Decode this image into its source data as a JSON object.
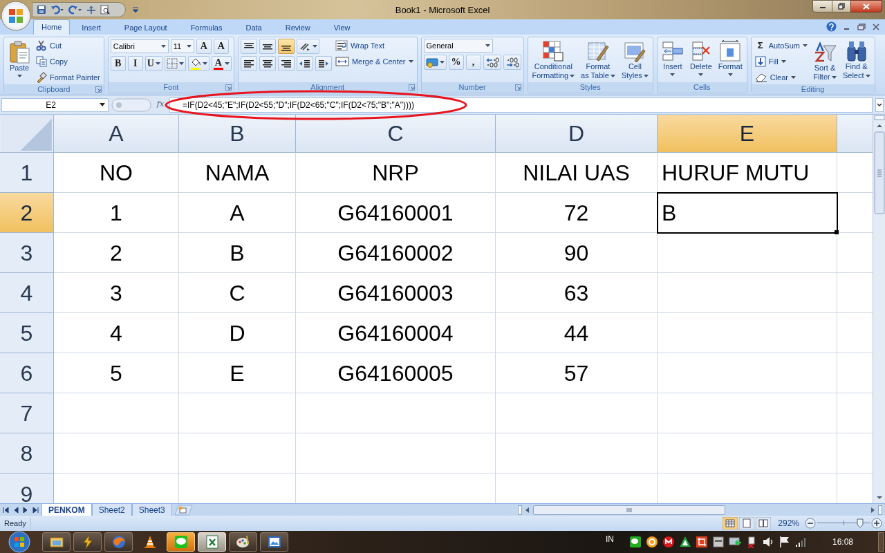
{
  "window": {
    "title": "Book1 - Microsoft Excel"
  },
  "ribbon_tabs": [
    {
      "label": "Home",
      "selected": true
    },
    {
      "label": "Insert",
      "selected": false
    },
    {
      "label": "Page Layout",
      "selected": false
    },
    {
      "label": "Formulas",
      "selected": false
    },
    {
      "label": "Data",
      "selected": false
    },
    {
      "label": "Review",
      "selected": false
    },
    {
      "label": "View",
      "selected": false
    }
  ],
  "ribbon_groups": [
    {
      "label": "Clipboard",
      "launcher": true,
      "columns": [
        [
          [
            {
              "kind": "large",
              "lines": [
                "Paste"
              ],
              "dropdown": true
            }
          ]
        ],
        [
          [
            {
              "kind": "small",
              "label": "Cut"
            }
          ],
          [
            {
              "kind": "small",
              "label": "Copy"
            }
          ],
          [
            {
              "kind": "small",
              "label": "Format Painter"
            }
          ]
        ]
      ]
    },
    {
      "label": "Font",
      "launcher": true,
      "columns": [
        [
          [
            {
              "kind": "field",
              "value": "Calibri"
            },
            {
              "kind": "field",
              "value": "11"
            },
            {
              "kind": "icon",
              "glyph": "A",
              "on": false
            },
            {
              "kind": "icon",
              "glyph": "A",
              "on": false
            }
          ],
          [
            {
              "kind": "icon",
              "glyph": "B",
              "on": false
            },
            {
              "kind": "icon",
              "glyph": "I",
              "on": false
            },
            {
              "kind": "icon",
              "glyph": "U",
              "on": false,
              "dropdown": true
            },
            {
              "kind": "icon",
              "on": false,
              "dropdown": true
            },
            {
              "kind": "icon",
              "on": false,
              "dropdown": true,
              "color": "#ffff00"
            },
            {
              "kind": "icon",
              "glyph": "A",
              "on": false,
              "dropdown": true,
              "color": "#ff0000"
            }
          ]
        ]
      ]
    },
    {
      "label": "Alignment",
      "launcher": true,
      "columns": [
        [
          [
            {
              "kind": "icon",
              "on": false
            },
            {
              "kind": "icon",
              "on": false
            },
            {
              "kind": "icon",
              "on": true
            },
            {
              "kind": "icon",
              "on": false,
              "dropdown": true
            }
          ],
          [
            {
              "kind": "icon",
              "on": false
            },
            {
              "kind": "icon",
              "on": false
            },
            {
              "kind": "icon",
              "on": false
            },
            {
              "kind": "icon",
              "on": false
            },
            {
              "kind": "icon",
              "on": false
            }
          ]
        ],
        [
          [
            {
              "kind": "small",
              "label": "Wrap Text"
            }
          ],
          [
            {
              "kind": "small",
              "label": "Merge & Center",
              "dropdown": true
            }
          ]
        ]
      ]
    },
    {
      "label": "Number",
      "launcher": true,
      "columns": [
        [
          [
            {
              "kind": "field",
              "value": "General"
            }
          ],
          [
            {
              "kind": "icon",
              "on": false,
              "dropdown": true
            },
            {
              "kind": "icon",
              "glyph": "%",
              "on": false
            },
            {
              "kind": "icon",
              "glyph": ",",
              "on": false
            },
            {
              "kind": "icon",
              "on": false
            },
            {
              "kind": "icon",
              "on": false
            }
          ]
        ]
      ]
    },
    {
      "label": "Styles",
      "launcher": false,
      "columns": [
        [
          [
            {
              "kind": "large",
              "lines": [
                "Conditional",
                "Formatting"
              ],
              "dropdown": true
            }
          ]
        ],
        [
          [
            {
              "kind": "large",
              "lines": [
                "Format",
                "as Table"
              ],
              "dropdown": true
            }
          ]
        ],
        [
          [
            {
              "kind": "large",
              "lines": [
                "Cell",
                "Styles"
              ],
              "dropdown": true
            }
          ]
        ]
      ]
    },
    {
      "label": "Cells",
      "launcher": false,
      "columns": [
        [
          [
            {
              "kind": "large",
              "lines": [
                "Insert"
              ],
              "dropdown": true
            }
          ]
        ],
        [
          [
            {
              "kind": "large",
              "lines": [
                "Delete"
              ],
              "dropdown": true
            }
          ]
        ],
        [
          [
            {
              "kind": "large",
              "lines": [
                "Format"
              ],
              "dropdown": true
            }
          ]
        ]
      ]
    },
    {
      "label": "Editing",
      "launcher": false,
      "columns": [
        [
          [
            {
              "kind": "small",
              "glyph": "Σ",
              "label": "AutoSum",
              "dropdown": true
            }
          ],
          [
            {
              "kind": "small",
              "label": "Fill",
              "dropdown": true
            }
          ],
          [
            {
              "kind": "small",
              "label": "Clear",
              "dropdown": true
            }
          ]
        ],
        [
          [
            {
              "kind": "large",
              "lines": [
                "Sort &",
                "Filter"
              ],
              "dropdown": true
            }
          ]
        ],
        [
          [
            {
              "kind": "large",
              "lines": [
                "Find &",
                "Select"
              ],
              "dropdown": true
            }
          ]
        ]
      ]
    }
  ],
  "formula_bar": {
    "name_box": "E2",
    "fx": "fx",
    "formula": "=IF(D2<45;\"E\";IF(D2<55;\"D\";IF(D2<65;\"C\";IF(D2<75;\"B\";\"A\"))))"
  },
  "sheet": {
    "columns": [
      {
        "label": "A",
        "selected": false
      },
      {
        "label": "B",
        "selected": false
      },
      {
        "label": "C",
        "selected": false
      },
      {
        "label": "D",
        "selected": false
      },
      {
        "label": "E",
        "selected": true
      }
    ],
    "rows": [
      {
        "label": "1",
        "selected": false,
        "cells": [
          {
            "text": "NO",
            "active": false
          },
          {
            "text": "NAMA",
            "active": false
          },
          {
            "text": "NRP",
            "active": false
          },
          {
            "text": "NILAI UAS",
            "active": false
          },
          {
            "text": "HURUF MUTU",
            "active": false
          }
        ]
      },
      {
        "label": "2",
        "selected": true,
        "cells": [
          {
            "text": "1",
            "active": false
          },
          {
            "text": "A",
            "active": false
          },
          {
            "text": "G64160001",
            "active": false
          },
          {
            "text": "72",
            "active": false
          },
          {
            "text": "B",
            "active": true
          }
        ]
      },
      {
        "label": "3",
        "selected": false,
        "cells": [
          {
            "text": "2",
            "active": false
          },
          {
            "text": "B",
            "active": false
          },
          {
            "text": "G64160002",
            "active": false
          },
          {
            "text": "90",
            "active": false
          },
          {
            "active": false
          }
        ]
      },
      {
        "label": "4",
        "selected": false,
        "cells": [
          {
            "text": "3",
            "active": false
          },
          {
            "text": "C",
            "active": false
          },
          {
            "text": "G64160003",
            "active": false
          },
          {
            "text": "63",
            "active": false
          },
          {
            "active": false
          }
        ]
      },
      {
        "label": "5",
        "selected": false,
        "cells": [
          {
            "text": "4",
            "active": false
          },
          {
            "text": "D",
            "active": false
          },
          {
            "text": "G64160004",
            "active": false
          },
          {
            "text": "44",
            "active": false
          },
          {
            "active": false
          }
        ]
      },
      {
        "label": "6",
        "selected": false,
        "cells": [
          {
            "text": "5",
            "active": false
          },
          {
            "text": "E",
            "active": false
          },
          {
            "text": "G64160005",
            "active": false
          },
          {
            "text": "57",
            "active": false
          },
          {
            "active": false
          }
        ]
      },
      {
        "label": "7",
        "selected": false,
        "cells": [
          {
            "active": false
          },
          {
            "active": false
          },
          {
            "active": false
          },
          {
            "active": false
          },
          {
            "active": false
          }
        ]
      },
      {
        "label": "8",
        "selected": false,
        "cells": [
          {
            "active": false
          },
          {
            "active": false
          },
          {
            "active": false
          },
          {
            "active": false
          },
          {
            "active": false
          }
        ]
      },
      {
        "label": "9",
        "selected": false,
        "cells": [
          {
            "active": false
          },
          {
            "active": false
          },
          {
            "active": false
          },
          {
            "active": false
          },
          {
            "active": false
          }
        ]
      }
    ]
  },
  "sheet_tabs": [
    {
      "label": "PENKOM",
      "selected": true
    },
    {
      "label": "Sheet2",
      "selected": false
    },
    {
      "label": "Sheet3",
      "selected": false
    }
  ],
  "status_bar": {
    "status": "Ready",
    "zoom": "292%",
    "zoom_slider": {
      "level": 0.82
    }
  },
  "taskbar": {
    "language": "IN",
    "clock": "16:08"
  }
}
